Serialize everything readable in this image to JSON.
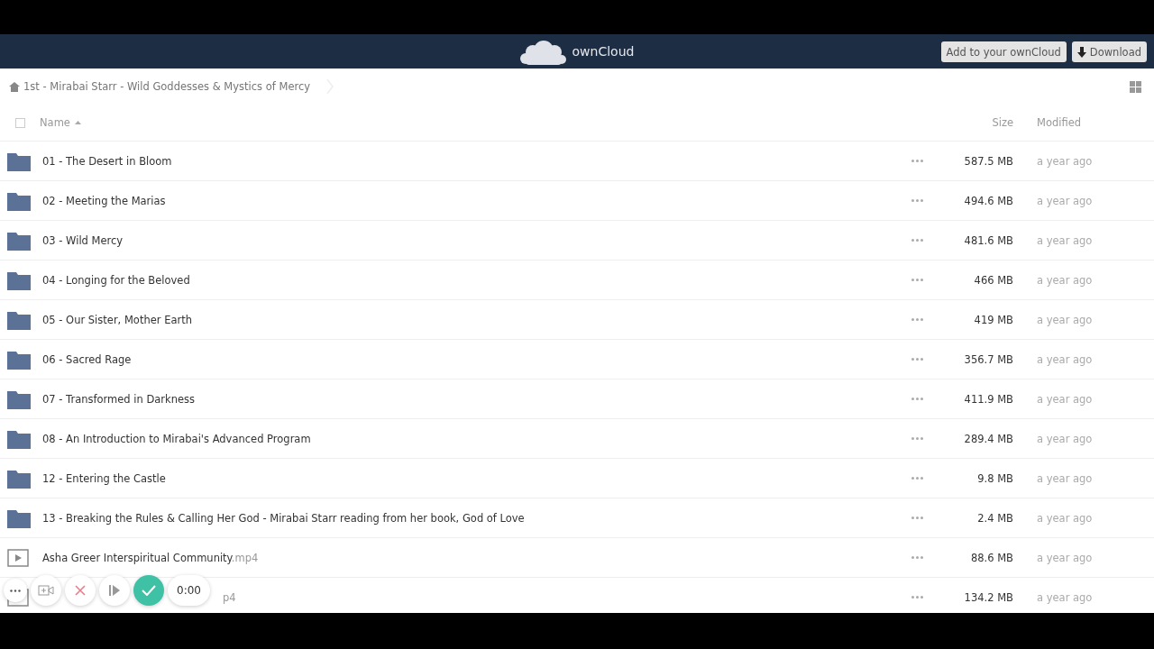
{
  "header": {
    "brand": "ownCloud",
    "buttons": [
      {
        "kind": "plain",
        "label": "Add to your ownCloud"
      },
      {
        "kind": "download",
        "label": "Download"
      }
    ]
  },
  "breadcrumb": {
    "label": "1st - Mirabai Starr - Wild Goddesses & Mystics of Mercy"
  },
  "table": {
    "select_all": {
      "checked": false
    },
    "columns": [
      {
        "label": "Name",
        "sorted": true
      },
      {
        "label": "Size",
        "sorted": false
      },
      {
        "label": "Modified",
        "sorted": false
      }
    ],
    "rows": [
      {
        "kind": "folder",
        "name": "01 - The Desert in Bloom",
        "size": "587.5 MB",
        "modified": "a year ago"
      },
      {
        "kind": "folder",
        "name": "02 - Meeting the Marias",
        "size": "494.6 MB",
        "modified": "a year ago"
      },
      {
        "kind": "folder",
        "name": "03 - Wild Mercy",
        "size": "481.6 MB",
        "modified": "a year ago"
      },
      {
        "kind": "folder",
        "name": "04 - Longing for the Beloved",
        "size": "466 MB",
        "modified": "a year ago"
      },
      {
        "kind": "folder",
        "name": "05 - Our Sister, Mother Earth",
        "size": "419 MB",
        "modified": "a year ago"
      },
      {
        "kind": "folder",
        "name": "06 - Sacred Rage",
        "size": "356.7 MB",
        "modified": "a year ago"
      },
      {
        "kind": "folder",
        "name": "07 - Transformed in Darkness",
        "size": "411.9 MB",
        "modified": "a year ago"
      },
      {
        "kind": "folder",
        "name": "08 - An Introduction to Mirabai's Advanced Program",
        "size": "289.4 MB",
        "modified": "a year ago"
      },
      {
        "kind": "folder",
        "name": "12 - Entering the Castle",
        "size": "9.8 MB",
        "modified": "a year ago"
      },
      {
        "kind": "folder",
        "name": "13 - Breaking the Rules & Calling Her God - Mirabai Starr reading from her book, God of Love",
        "size": "2.4 MB",
        "modified": "a year ago"
      },
      {
        "kind": "video",
        "name": "Asha Greer Interspiritual Community",
        "ext": ".mp4",
        "size": "88.6 MB",
        "modified": "a year ago"
      },
      {
        "kind": "video",
        "ext": "p4",
        "size": "134.2 MB",
        "modified": "a year ago"
      }
    ]
  },
  "recorder": {
    "timer": "0:00"
  }
}
